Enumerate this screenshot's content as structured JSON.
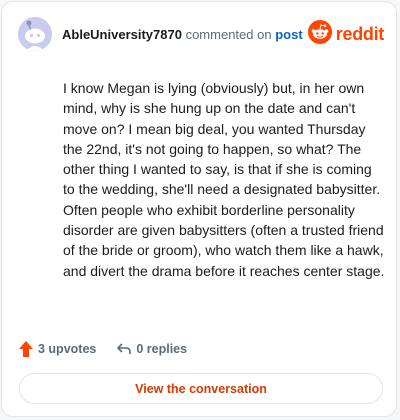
{
  "comment": {
    "username": "AbleUniversity7870",
    "action_text": "commented on",
    "post_link": "post",
    "body": "I know Megan is lying (obviously) but, in her own mind, why is she hung up on the date and can't move on? I mean big deal, you wanted Thursday the 22nd, it's not going to happen, so what? The other thing I wanted to say, is that if she is coming to the wedding, she'll need a designated babysitter. Often people who exhibit borderline personality disorder are given babysitters (often a trusted friend of the bride or groom), who watch them like a hawk, and divert the drama before it reaches center stage."
  },
  "brand": {
    "name": "reddit",
    "logo_icon": "reddit-snoo-icon",
    "color": "#ff4500"
  },
  "stats": {
    "upvotes": "3 upvotes",
    "upvote_icon": "upvote-arrow-icon",
    "upvote_color": "#ff4500",
    "replies": "0 replies",
    "reply_icon": "reply-arrow-icon"
  },
  "cta": {
    "label": "View the conversation",
    "color": "#d93a00"
  },
  "avatar": {
    "icon": "default-user-avatar-icon",
    "background": "#c9ccef"
  }
}
